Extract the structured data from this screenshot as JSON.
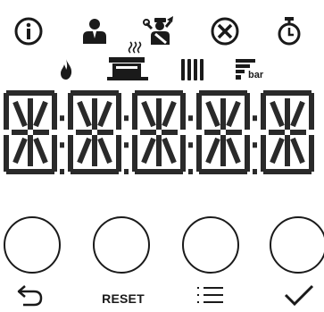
{
  "status_icons": {
    "info": "info-icon",
    "user": "user-icon",
    "service": "service-technician-icon",
    "fault": "fault-cross-icon",
    "timer": "timer-icon",
    "flame": "flame-icon",
    "hot_water": "hot-water-tank-icon",
    "radiator": "radiator-icon",
    "pressure": "pressure-bar-icon"
  },
  "pressure_unit": "bar",
  "display": {
    "digit_count": 5,
    "all_segments_lit": true,
    "segment_color": "#2a2a2a"
  },
  "buttons": [
    {
      "name": "back",
      "icon": "back-arrow-icon"
    },
    {
      "name": "reset",
      "label": "RESET"
    },
    {
      "name": "menu",
      "icon": "menu-list-icon"
    },
    {
      "name": "confirm",
      "icon": "checkmark-icon"
    }
  ]
}
